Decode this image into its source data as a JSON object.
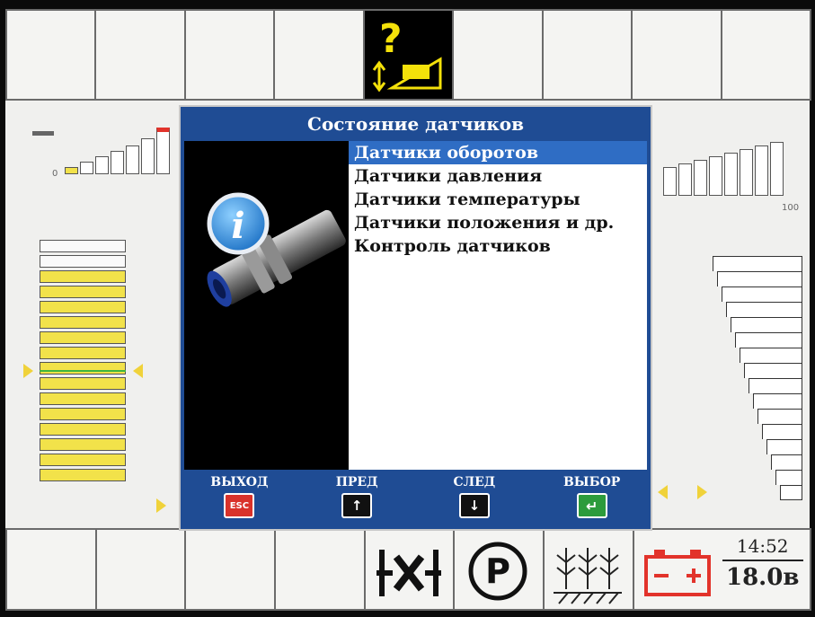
{
  "dialog": {
    "title": "Состояние датчиков",
    "menu": [
      {
        "label": "Датчики оборотов",
        "selected": true
      },
      {
        "label": "Датчики давления",
        "selected": false
      },
      {
        "label": "Датчики температуры",
        "selected": false
      },
      {
        "label": "Датчики положения и др.",
        "selected": false
      },
      {
        "label": "Контроль датчиков",
        "selected": false
      }
    ],
    "footer": [
      {
        "label": "ВЫХОД",
        "key": "ESC",
        "key_icon": "esc-key-icon",
        "color": "#d9322a"
      },
      {
        "label": "ПРЕД",
        "key": "↑",
        "key_icon": "arrow-up-icon",
        "color": "#111111"
      },
      {
        "label": "СЛЕД",
        "key": "↓",
        "key_icon": "arrow-down-icon",
        "color": "#111111"
      },
      {
        "label": "ВЫБОР",
        "key": "↵",
        "key_icon": "enter-icon",
        "color": "#2c9b3c"
      }
    ]
  },
  "gauges": {
    "left_min": "0",
    "right_max": "100"
  },
  "status": {
    "time": "14:52",
    "voltage": "18.0в"
  },
  "icons": {
    "top_center": "sensor-question-icon",
    "bottom": [
      "neutral-x-icon",
      "parking-icon",
      "crop-field-icon",
      "battery-icon"
    ]
  },
  "colors": {
    "dialog_bg": "#1f4c94",
    "selection": "#2f6dc4",
    "warning_yellow": "#f2e24a",
    "battery_red": "#e2332b"
  }
}
